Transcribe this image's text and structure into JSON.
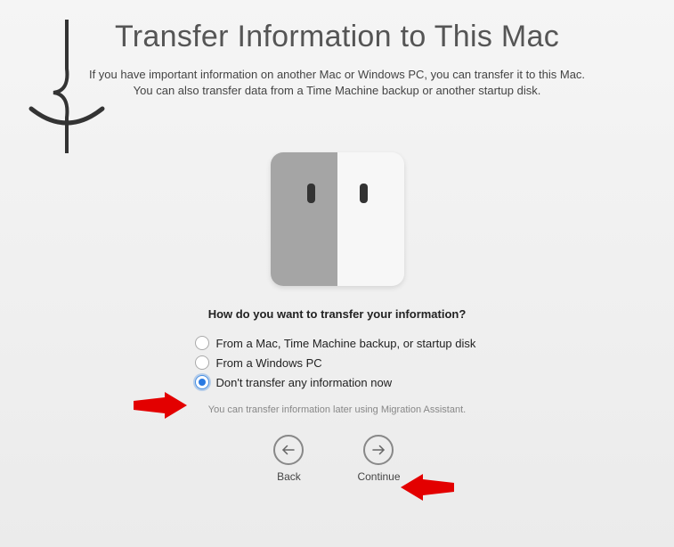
{
  "title": "Transfer Information to This Mac",
  "subtitle_line1": "If you have important information on another Mac or Windows PC, you can transfer it to this Mac.",
  "subtitle_line2": "You can also transfer data from a Time Machine backup or another startup disk.",
  "question": "How do you want to transfer your information?",
  "options": [
    {
      "label": "From a Mac, Time Machine backup, or startup disk",
      "selected": false
    },
    {
      "label": "From a Windows PC",
      "selected": false
    },
    {
      "label": "Don't transfer any information now",
      "selected": true
    }
  ],
  "note": "You can transfer information later using Migration Assistant.",
  "nav": {
    "back": "Back",
    "continue": "Continue"
  }
}
